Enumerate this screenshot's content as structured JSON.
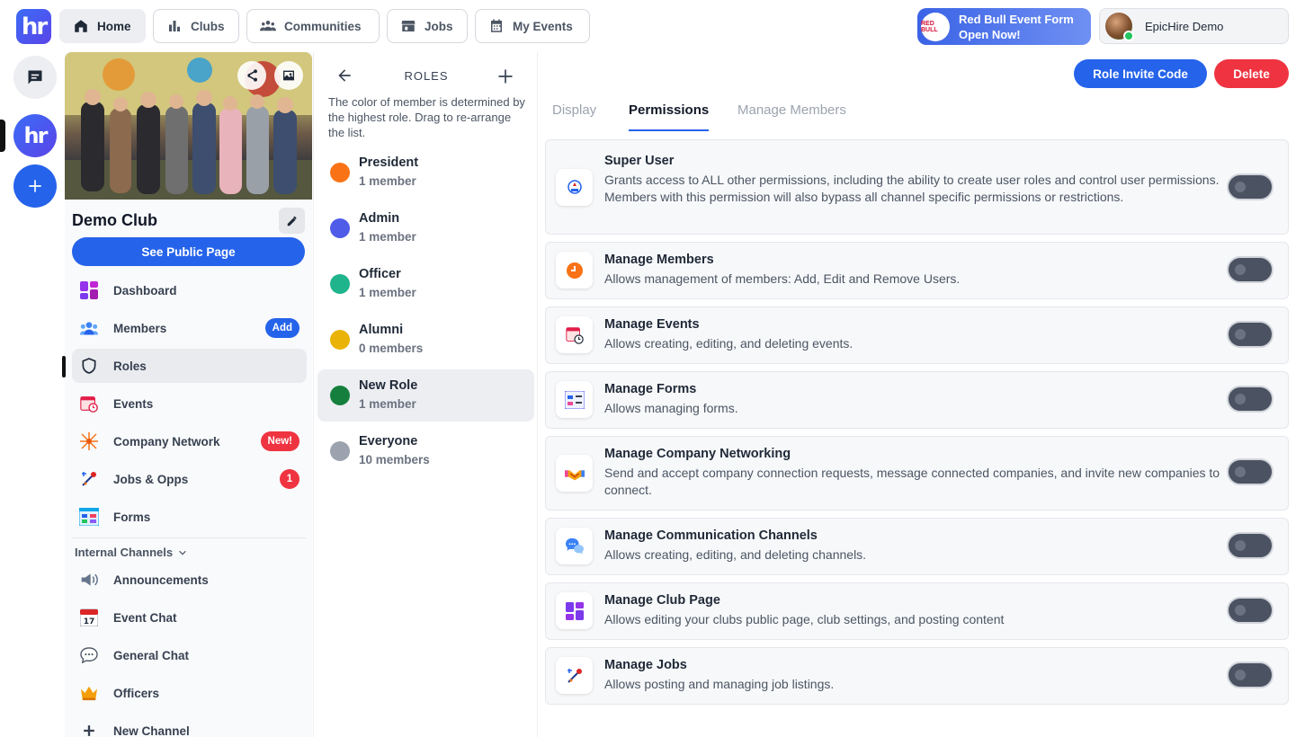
{
  "nav": {
    "home": "Home",
    "clubs": "Clubs",
    "communities": "Communities",
    "jobs": "Jobs",
    "my_events": "My Events",
    "promo_line1": "Red Bull Event Form",
    "promo_line2": "Open Now!",
    "promo_badge": "RED BULL",
    "user_name": "EpicHire Demo"
  },
  "club": {
    "name": "Demo Club",
    "public_button": "See Public Page",
    "items": [
      {
        "label": "Dashboard"
      },
      {
        "label": "Members",
        "badge": "Add"
      },
      {
        "label": "Roles"
      },
      {
        "label": "Events"
      },
      {
        "label": "Company Network",
        "badge": "New!"
      },
      {
        "label": "Jobs & Opps",
        "badge": "1"
      },
      {
        "label": "Forms"
      }
    ],
    "channels_header": "Internal Channels",
    "channels": [
      {
        "label": "Announcements"
      },
      {
        "label": "Event Chat"
      },
      {
        "label": "General Chat"
      },
      {
        "label": "Officers"
      },
      {
        "label": "New Channel"
      }
    ]
  },
  "roles": {
    "title": "ROLES",
    "note": "The color of member is determined by the highest role. Drag to re-arrange the list.",
    "list": [
      {
        "name": "President",
        "count": "1 member",
        "color": "#f97316"
      },
      {
        "name": "Admin",
        "count": "1 member",
        "color": "#4f5ce8"
      },
      {
        "name": "Officer",
        "count": "1 member",
        "color": "#20b48c"
      },
      {
        "name": "Alumni",
        "count": "0 members",
        "color": "#eab308"
      },
      {
        "name": "New Role",
        "count": "1 member",
        "color": "#15803d"
      },
      {
        "name": "Everyone",
        "count": "10 members",
        "color": "#9ca3af"
      }
    ]
  },
  "main": {
    "invite_button": "Role Invite Code",
    "delete_button": "Delete",
    "tabs": [
      "Display",
      "Permissions",
      "Manage Members"
    ],
    "permissions": [
      {
        "title": "Super User",
        "desc": "Grants access to ALL other permissions, including the ability to create user roles and control user permissions. Members with this permission will also bypass all channel specific permissions or restrictions.",
        "enabled": false
      },
      {
        "title": "Manage Members",
        "desc": "Allows management of members: Add, Edit and Remove Users.",
        "enabled": false
      },
      {
        "title": "Manage Events",
        "desc": "Allows creating, editing, and deleting events.",
        "enabled": false
      },
      {
        "title": "Manage Forms",
        "desc": "Allows managing forms.",
        "enabled": false
      },
      {
        "title": "Manage Company Networking",
        "desc": "Send and accept company connection requests, message connected companies, and invite new companies to connect.",
        "enabled": false
      },
      {
        "title": "Manage Communication Channels",
        "desc": "Allows creating, editing, and deleting channels.",
        "enabled": false
      },
      {
        "title": "Manage Club Page",
        "desc": "Allows editing your clubs public page, club settings, and posting content",
        "enabled": false
      },
      {
        "title": "Manage Jobs",
        "desc": "Allows posting and managing job listings.",
        "enabled": false
      }
    ]
  },
  "colors": {
    "accent": "#2563eb",
    "danger": "#ef3340",
    "badge_red": "#ef3340"
  }
}
